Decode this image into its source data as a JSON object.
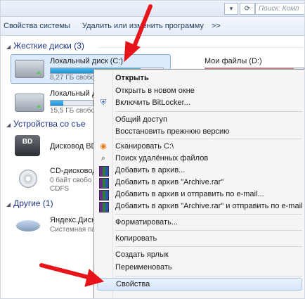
{
  "address_bar": {
    "search_placeholder": "Поиск: Комп"
  },
  "toolbar": {
    "system_properties": "Свойства системы",
    "uninstall": "Удалить или изменить программу",
    "more": ">>"
  },
  "groups": {
    "hard_drives": "Жесткие диски (3)",
    "removable": "Устройства со съе",
    "other": "Другие (1)"
  },
  "drives": {
    "c": {
      "name": "Локальный диск (C:)",
      "free": "8,27 ГБ свобо",
      "usage": 0.8
    },
    "d": {
      "name": "Мои файлы (D:)",
      "usage": 0.9
    },
    "second": {
      "name": "Локальный д",
      "free": "15,5 ГБ свобо",
      "usage": 0.3
    },
    "bd": {
      "name": "Дисковод BD",
      "badge": "BD"
    },
    "cd": {
      "name": "CD-дисковод",
      "line1": "0 байт свобо",
      "line2": "CDFS"
    },
    "yandex": {
      "name": "Яндекс.Диск",
      "sub": "Системная па"
    }
  },
  "context_menu": {
    "open": "Открыть",
    "open_new_window": "Открыть в новом окне",
    "bitlocker": "Включить BitLocker...",
    "sharing": "Общий доступ",
    "restore": "Восстановить прежнюю версию",
    "scan": "Сканировать C:\\",
    "deleted_search": "Поиск удалённых файлов",
    "add_archive": "Добавить в архив...",
    "add_archive_rar": "Добавить в архив \"Archive.rar\"",
    "add_archive_email": "Добавить в архив и отправить по e-mail...",
    "add_rar_email": "Добавить в архив \"Archive.rar\" и отправить по e-mail",
    "format": "Форматировать...",
    "copy": "Копировать",
    "create_shortcut": "Создать ярлык",
    "rename": "Переименовать",
    "properties": "Свойства"
  },
  "colors": {
    "arrow": "#e8141b",
    "selection": "#dbeafd",
    "group_header": "#1e3287"
  }
}
